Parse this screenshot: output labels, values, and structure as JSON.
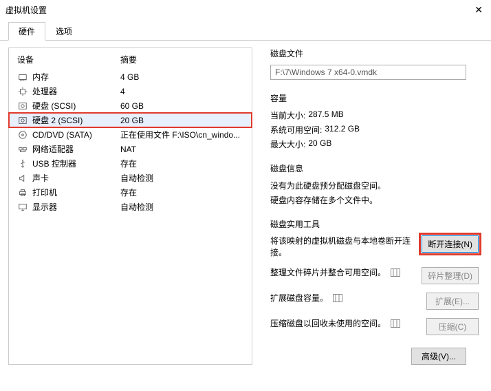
{
  "window": {
    "title": "虚拟机设置"
  },
  "tabs": {
    "hardware": "硬件",
    "options": "选项"
  },
  "left": {
    "header_device": "设备",
    "header_summary": "摘要",
    "items": [
      {
        "icon": "memory-icon",
        "name": "内存",
        "summary": "4 GB"
      },
      {
        "icon": "cpu-icon",
        "name": "处理器",
        "summary": "4"
      },
      {
        "icon": "disk-icon",
        "name": "硬盘 (SCSI)",
        "summary": "60 GB"
      },
      {
        "icon": "disk-icon",
        "name": "硬盘 2 (SCSI)",
        "summary": "20 GB"
      },
      {
        "icon": "cd-icon",
        "name": "CD/DVD (SATA)",
        "summary": "正在使用文件 F:\\ISO\\cn_windo..."
      },
      {
        "icon": "network-icon",
        "name": "网络适配器",
        "summary": "NAT"
      },
      {
        "icon": "usb-icon",
        "name": "USB 控制器",
        "summary": "存在"
      },
      {
        "icon": "sound-icon",
        "name": "声卡",
        "summary": "自动检测"
      },
      {
        "icon": "printer-icon",
        "name": "打印机",
        "summary": "存在"
      },
      {
        "icon": "display-icon",
        "name": "显示器",
        "summary": "自动检测"
      }
    ]
  },
  "right": {
    "disk_file_title": "磁盘文件",
    "disk_file_value": "F:\\7\\Windows 7 x64-0.vmdk",
    "capacity_title": "容量",
    "current_size_label": "当前大小:",
    "current_size_value": "287.5 MB",
    "free_space_label": "系统可用空间:",
    "free_space_value": "312.2 GB",
    "max_size_label": "最大大小:",
    "max_size_value": "20 GB",
    "disk_info_title": "磁盘信息",
    "disk_info_line1": "没有为此硬盘预分配磁盘空间。",
    "disk_info_line2": "硬盘内容存储在多个文件中。",
    "tools_title": "磁盘实用工具",
    "tool1_desc": "将该映射的虚拟机磁盘与本地卷断开连接。",
    "tool1_btn": "断开连接(N)",
    "tool2_desc": "整理文件碎片并整合可用空间。",
    "tool2_btn": "碎片整理(D)",
    "tool3_desc": "扩展磁盘容量。",
    "tool3_btn": "扩展(E)...",
    "tool4_desc": "压缩磁盘以回收未使用的空间。",
    "tool4_btn": "压缩(C)",
    "advanced_btn": "高级(V)..."
  }
}
